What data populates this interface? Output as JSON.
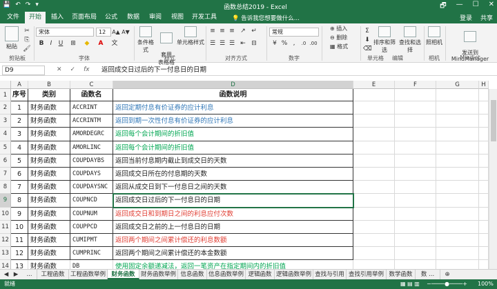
{
  "window": {
    "title": "函数总结2019 - Excel",
    "quick_access": [
      "💾",
      "↶",
      "↷",
      "▾"
    ],
    "controls": [
      "🗗",
      "—",
      "☐",
      "✕"
    ]
  },
  "tabs": [
    "文件",
    "开始",
    "插入",
    "页面布局",
    "公式",
    "数据",
    "审阅",
    "视图",
    "开发工具"
  ],
  "tell_me": "告诉我您想要做什么...",
  "account": [
    "登录",
    "共享"
  ],
  "ribbon": {
    "paste": "粘贴",
    "clipboard": "剪贴板",
    "font_name": "宋体",
    "font_size": "12",
    "font_group": "字体",
    "cond_format": "条件格式",
    "table_format": "套用\n表格格式",
    "cell_style": "单元格样式",
    "style_group": "样式",
    "align_group": "对齐方式",
    "number_format": "常规",
    "number_group": "数字",
    "insert": "插入",
    "delete": "删除",
    "format": "格式",
    "cells_group": "单元格",
    "sort_filter": "排序和筛选",
    "find_select": "查找和选择",
    "edit_group": "编辑",
    "photo": "照相机",
    "camera_group": "相机",
    "send_mm": "发送到\nMindManager",
    "mindjet_group": "Mindjet"
  },
  "formula_bar": {
    "name_box": "D9",
    "formula": "返回成交日过后的下一付息日的日期"
  },
  "columns": [
    "A",
    "B",
    "C",
    "D",
    "E",
    "F",
    "G",
    "H"
  ],
  "header_row": [
    "序号",
    "类别",
    "函数名",
    "函数说明"
  ],
  "rows": [
    {
      "n": "1",
      "cat": "财务函数",
      "fn": "ACCRINT",
      "desc": "返回定期付息有价证券的应计利息",
      "color": "#2e75b6"
    },
    {
      "n": "2",
      "cat": "财务函数",
      "fn": "ACCRINTM",
      "desc": "返回到期一次性付息有价证券的应计利息",
      "color": "#2e75b6"
    },
    {
      "n": "3",
      "cat": "财务函数",
      "fn": "AMORDEGRC",
      "desc": "返回每个会计期间的折旧值",
      "color": "#00a651"
    },
    {
      "n": "4",
      "cat": "财务函数",
      "fn": "AMORLINC",
      "desc": "返回每个会计期间的折旧值",
      "color": "#00a651"
    },
    {
      "n": "5",
      "cat": "财务函数",
      "fn": "COUPDAYBS",
      "desc": "返回当前付息期内截止到成交日的天数",
      "color": "#222222"
    },
    {
      "n": "6",
      "cat": "财务函数",
      "fn": "COUPDAYS",
      "desc": "返回成交日所在的付息期的天数",
      "color": "#222222"
    },
    {
      "n": "7",
      "cat": "财务函数",
      "fn": "COUPDAYSNC",
      "desc": "返回从成交日到下一付息日之间的天数",
      "color": "#222222"
    },
    {
      "n": "8",
      "cat": "财务函数",
      "fn": "COUPNCD",
      "desc": "返回成交日过后的下一付息日的日期",
      "color": "#222222"
    },
    {
      "n": "9",
      "cat": "财务函数",
      "fn": "COUPNUM",
      "desc": "返回成交日和到期日之间的利息应付次数",
      "color": "#e03c31"
    },
    {
      "n": "10",
      "cat": "财务函数",
      "fn": "COUPPCD",
      "desc": "返回成交日之前的上一付息日的日期",
      "color": "#222222"
    },
    {
      "n": "11",
      "cat": "财务函数",
      "fn": "CUMIPMT",
      "desc": "返回两个期间之间累计偿还的利息数额",
      "color": "#e03c31"
    },
    {
      "n": "12",
      "cat": "财务函数",
      "fn": "CUMPRINC",
      "desc": "返回两个期间之间累计偿还的本金数额",
      "color": "#222222"
    },
    {
      "n": "13",
      "cat": "财务函数",
      "fn": "DB",
      "desc": "使用固定余额递减法，返回一笔资产在指定期间内的折旧值",
      "color": "#00a651"
    }
  ],
  "row_numbers": [
    "1",
    "2",
    "3",
    "4",
    "5",
    "6",
    "7",
    "8",
    "9",
    "10",
    "11",
    "12",
    "13",
    "14"
  ],
  "sheet_tabs": [
    "...",
    "工程函数",
    "工程函数举例",
    "财务函数",
    "财务函数举例",
    "信息函数",
    "信息函数举例",
    "逻辑函数",
    "逻辑函数举例",
    "查找与引用",
    "查找引用举例",
    "数学函数",
    "数 ..."
  ],
  "status": {
    "ready": "就绪",
    "zoom": "100%"
  }
}
